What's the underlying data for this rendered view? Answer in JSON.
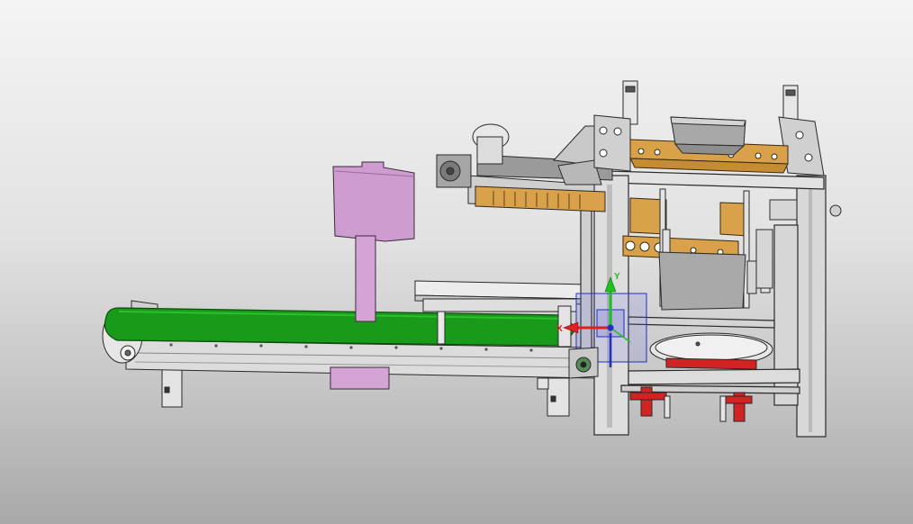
{
  "viewport": {
    "background_top": "#f4f4f4",
    "background_bottom": "#a9a9a9"
  },
  "model": {
    "conveyor_belt_color": "#1a9a1a",
    "frame_color": "#dcdcdc",
    "bracket_color": "#d9a24a",
    "control_box_color": "#cf9ccf",
    "base_color": "#d22222"
  },
  "triad": {
    "x_label": "X",
    "y_label": "Y",
    "x_color": "#e02020",
    "y_color": "#20c020",
    "z_color": "#2030c0"
  }
}
